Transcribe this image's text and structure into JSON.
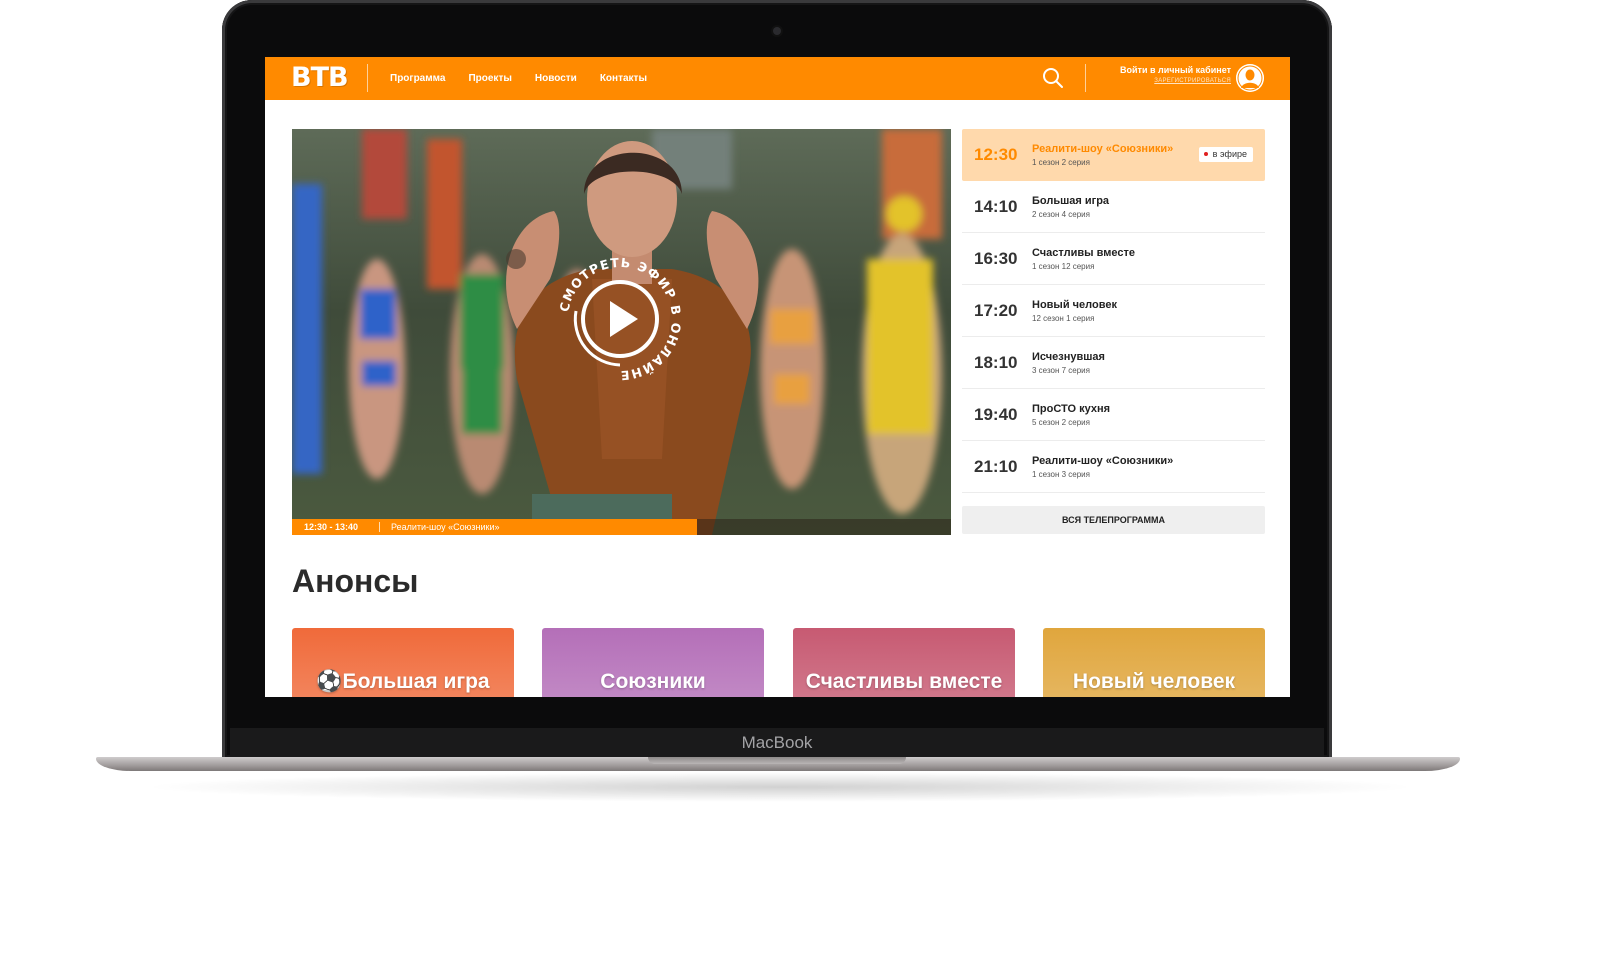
{
  "device": {
    "brand": "MacBook"
  },
  "header": {
    "logo": "ВТВ",
    "nav": [
      "Программа",
      "Проекты",
      "Новости",
      "Контакты"
    ],
    "login_label": "Войти в личный кабинет",
    "register_label": "ЗАРЕГИСТРИРОВАТЬСЯ",
    "icons": {
      "search": "search-icon",
      "avatar": "user-avatar-icon"
    },
    "accent": "#ff8a00"
  },
  "player": {
    "watch_label": "СМОТРЕТЬ ЭФИР В ОНЛАЙНЕ",
    "now_time": "12:30 - 13:40",
    "now_title": "Реалити-шоу «Союзники»",
    "progress": 0.615,
    "icon": "play-icon"
  },
  "schedule": {
    "onair_label": "в эфире",
    "items": [
      {
        "time": "12:30",
        "title": "Реалити-шоу «Союзники»",
        "subtitle": "1 сезон 2 серия",
        "active": true
      },
      {
        "time": "14:10",
        "title": "Большая игра",
        "subtitle": "2 сезон 4 серия"
      },
      {
        "time": "16:30",
        "title": "Счастливы вместе",
        "subtitle": "1 сезон 12 серия"
      },
      {
        "time": "17:20",
        "title": "Новый человек",
        "subtitle": "12 сезон 1 серия"
      },
      {
        "time": "18:10",
        "title": "Исчезнувшая",
        "subtitle": "3 сезон 7 серия"
      },
      {
        "time": "19:40",
        "title": "ПроСТО кухня",
        "subtitle": "5 сезон 2 серия"
      },
      {
        "time": "21:10",
        "title": "Реалити-шоу «Союзники»",
        "subtitle": "1 сезон 3 серия"
      }
    ],
    "all_label": "ВСЯ ТЕЛЕПРОГРАММА"
  },
  "anons": {
    "title": "Анонсы",
    "cards": [
      {
        "label": "⚽Большая игра",
        "color": "#f06a3a"
      },
      {
        "label": "Союзники",
        "color": "#b46fb8"
      },
      {
        "label": "Счастливы вместе",
        "color": "#c75a72"
      },
      {
        "label": "Новый человек",
        "color": "#e0a63d"
      }
    ]
  }
}
